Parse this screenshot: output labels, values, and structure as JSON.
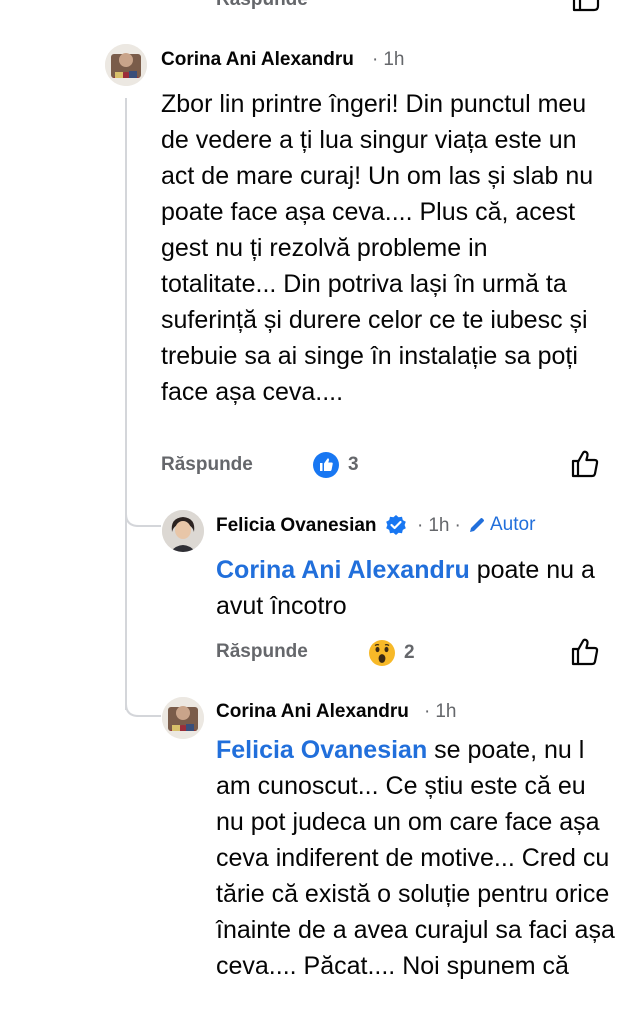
{
  "top_reply_label": "Răspunde",
  "comments": [
    {
      "author": "Corina Ani Alexandru",
      "time": "1h",
      "text": "Zbor lin printre îngeri! Din punctul meu de vedere a ți lua singur viața este un act de mare curaj! Un om las și slab nu poate face așa ceva.... Plus că, acest gest nu ți rezolvă probleme in totalitate... Din potriva lași în urmă ta suferință și durere celor ce te iubesc și trebuie sa ai singe în instalație sa poți face așa ceva....",
      "reply_label": "Răspunde",
      "reaction_icon": "like-reaction-icon",
      "reaction_count": "3"
    }
  ],
  "replies": [
    {
      "author": "Felicia Ovanesian",
      "verified": true,
      "time": "1h",
      "author_badge": "Autor",
      "mention": "Corina Ani Alexandru",
      "text": " poate nu a avut încotro",
      "reply_label": "Răspunde",
      "reaction_icon": "wow-reaction-icon",
      "reaction_count": "2"
    },
    {
      "author": "Corina Ani Alexandru",
      "time": "1h",
      "mention": "Felicia Ovanesian",
      "text": " se poate, nu l am cunoscut... Ce știu este că eu nu pot judeca un om care face așa ceva indiferent de motive... Cred cu tărie că există o soluție pentru orice înainte de a avea curajul sa faci așa ceva.... Păcat.... Noi spunem că"
    }
  ],
  "colors": {
    "link": "#216fdb",
    "secondary_text": "#65676b",
    "like_blue": "#1877f2",
    "verified_blue": "#1877f2"
  }
}
